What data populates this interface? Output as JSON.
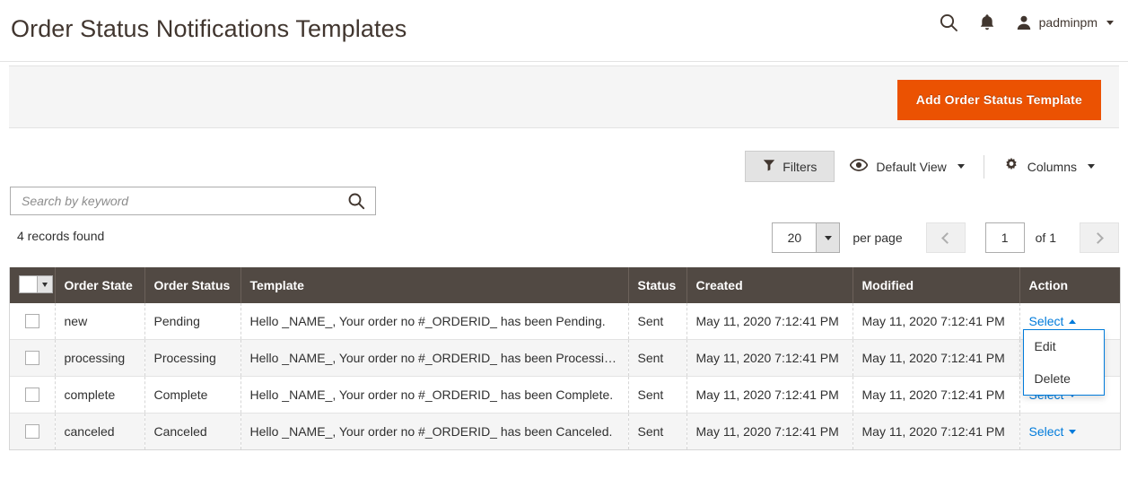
{
  "header": {
    "title": "Order Status Notifications Templates",
    "search_icon": "search-icon",
    "notifications_icon": "bell-icon",
    "user_name": "padminpm"
  },
  "page_actions": {
    "add_button_label": "Add Order Status Template"
  },
  "toolbar": {
    "filters_label": "Filters",
    "view_label": "Default View",
    "columns_label": "Columns"
  },
  "search": {
    "placeholder": "Search by keyword",
    "value": ""
  },
  "grid_info": {
    "records_found": "4 records found"
  },
  "pager": {
    "limit_value": "20",
    "per_page_label": "per page",
    "current_page": "1",
    "of_label": "of 1"
  },
  "grid": {
    "columns": [
      "Order State",
      "Order Status",
      "Template",
      "Status",
      "Created",
      "Modified",
      "Action"
    ],
    "action_label": "Select",
    "rows": [
      {
        "order_state": "new",
        "order_status": "Pending",
        "template": "Hello _NAME_, Your order no #_ORDERID_ has been Pending.",
        "status": "Sent",
        "created": "May 11, 2020 7:12:41 PM",
        "modified": "May 11, 2020 7:12:41 PM",
        "action": "Select"
      },
      {
        "order_state": "processing",
        "order_status": "Processing",
        "template": "Hello _NAME_, Your order no #_ORDERID_ has been Processing.",
        "status": "Sent",
        "created": "May 11, 2020 7:12:41 PM",
        "modified": "May 11, 2020 7:12:41 PM",
        "action": "Select"
      },
      {
        "order_state": "complete",
        "order_status": "Complete",
        "template": "Hello _NAME_, Your order no #_ORDERID_ has been Complete.",
        "status": "Sent",
        "created": "May 11, 2020 7:12:41 PM",
        "modified": "May 11, 2020 7:12:41 PM",
        "action": "Select"
      },
      {
        "order_state": "canceled",
        "order_status": "Canceled",
        "template": "Hello _NAME_, Your order no #_ORDERID_ has been Canceled.",
        "status": "Sent",
        "created": "May 11, 2020 7:12:41 PM",
        "modified": "May 11, 2020 7:12:41 PM",
        "action": "Select"
      }
    ]
  },
  "action_menu": {
    "open_on_row": 0,
    "items": [
      "Edit",
      "Delete"
    ]
  },
  "colors": {
    "primary_button": "#eb5202",
    "grid_header": "#514943",
    "link": "#007bdb"
  }
}
